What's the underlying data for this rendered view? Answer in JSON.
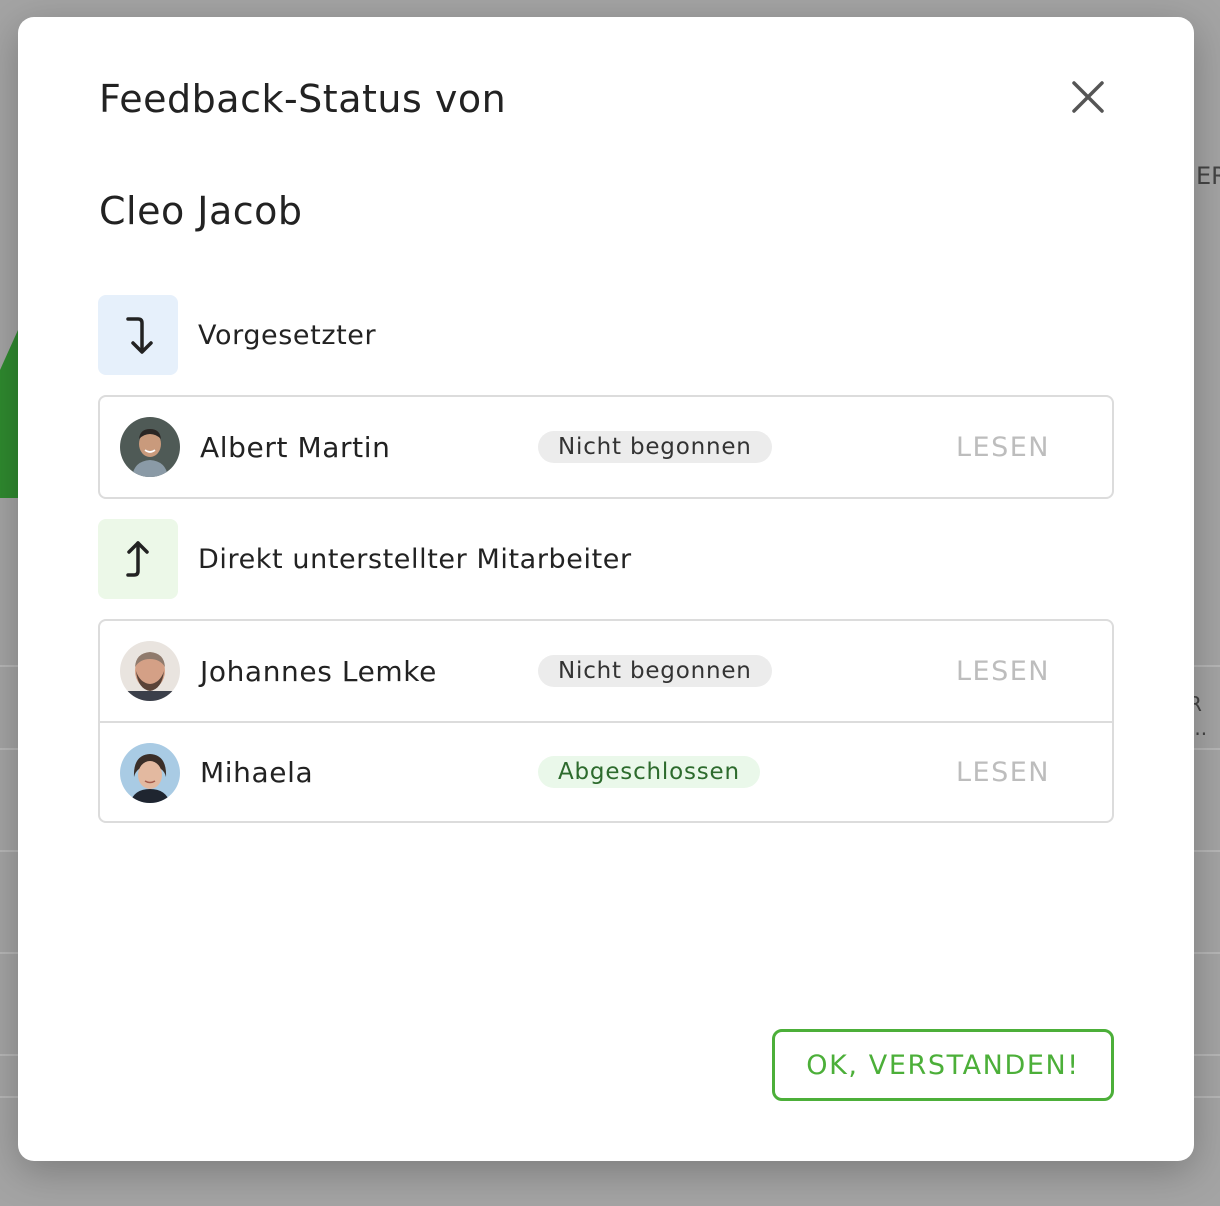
{
  "background": {
    "right_text_top": "ER",
    "right_text_mid": "R ..."
  },
  "modal": {
    "title": "Feedback-Status von",
    "person": "Cleo Jacob",
    "close_icon": "close-icon",
    "ok_label": "OK, VERSTANDEN!"
  },
  "sections": [
    {
      "label": "Vorgesetzter",
      "icon": "arrow-down-turn-icon",
      "accent": "#e6f0fb",
      "rows": [
        {
          "name": "Albert Martin",
          "status": "Nicht begonnen",
          "status_kind": "grey",
          "action": "LESEN"
        }
      ]
    },
    {
      "label": "Direkt unterstellter Mitarbeiter",
      "icon": "arrow-up-turn-icon",
      "accent": "#ecf8e8",
      "rows": [
        {
          "name": "Johannes Lemke",
          "status": "Nicht begonnen",
          "status_kind": "grey",
          "action": "LESEN"
        },
        {
          "name": "Mihaela",
          "status": "Abgeschlossen",
          "status_kind": "green",
          "action": "LESEN"
        }
      ]
    }
  ],
  "colors": {
    "primary_green": "#4caf39",
    "muted_action": "#bdbdbd"
  }
}
